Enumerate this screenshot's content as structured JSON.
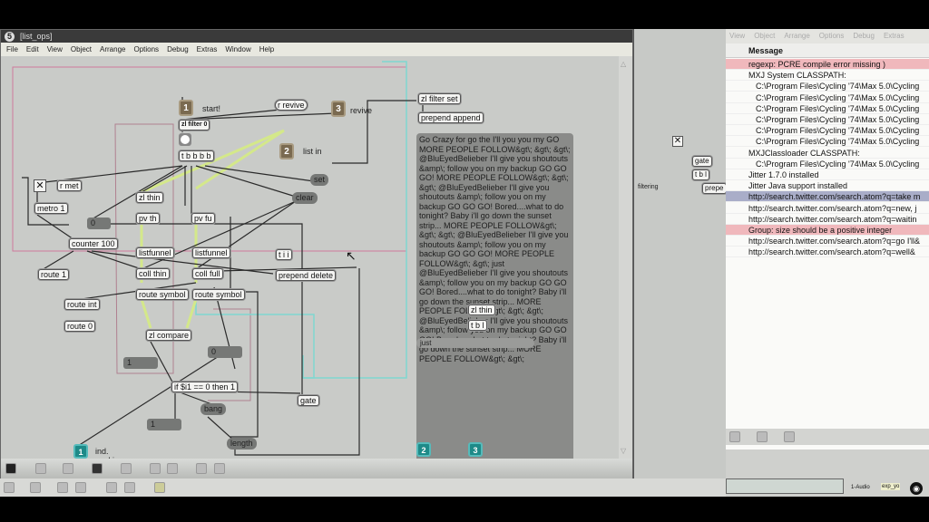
{
  "patcher": {
    "title_num": "5",
    "title": "[list_ops]",
    "menu": [
      "File",
      "Edit",
      "View",
      "Object",
      "Arrange",
      "Options",
      "Debug",
      "Extras",
      "Window",
      "Help"
    ],
    "inlets": [
      {
        "num": "1",
        "label": "start!"
      },
      {
        "num": "3",
        "label": "revive"
      },
      {
        "num": "2",
        "label": "list in"
      }
    ],
    "outlets": [
      {
        "num": "1",
        "label": "ind. working"
      },
      {
        "num": "2"
      },
      {
        "num": "3"
      }
    ],
    "objects": {
      "r_revive": "r revive",
      "zl_filter0": "zl filter 0",
      "tbbbb": "t b b b b",
      "r_met": "r met",
      "metro": "metro 1",
      "zl_thin": "zl thin",
      "pv_th": "pv th",
      "pv_fu": "pv fu",
      "counter": "counter 100",
      "listfunnel1": "listfunnel",
      "listfunnel2": "listfunnel",
      "tii": "t i i",
      "route1": "route 1",
      "coll_thin": "coll thin",
      "coll_full": "coll full",
      "prepend_delete": "prepend delete",
      "route_symbol1": "route symbol",
      "route_symbol2": "route symbol",
      "route_int": "route int",
      "route0": "route 0",
      "zl_compare": "zl compare",
      "if_expr": "if $i1 == 0 then 1",
      "gate": "gate",
      "zl_filter_set": "zl filter set",
      "prepend_append": "prepend append",
      "zl_thin2": "zl thin",
      "tbl": "t b l"
    },
    "messages": {
      "set": "set",
      "clear": "clear",
      "num0": "0",
      "num0b": "0",
      "num1a": "1",
      "num1b": "1",
      "bang": "bang",
      "length": "length",
      "just": "just"
    },
    "big_message": "Go Crazy for go the I'll you you my GO MORE PEOPLE FOLLOW&gt\\; &gt\\; &gt\\; @BluEyedBelieber I'll give you shoutouts &amp\\; follow you on my backup GO GO GO! MORE PEOPLE FOLLOW&gt\\; &gt\\; &gt\\; @BluEyedBelieber I'll give you shoutouts &amp\\; follow you on my backup GO GO GO! Bored....what to do tonight? Baby i'll go down the sunset strip... MORE PEOPLE FOLLOW&gt\\; &gt\\; &gt\\; @BluEyedBelieber I'll give you shoutouts &amp\\; follow you on my backup GO GO GO! MORE PEOPLE FOLLOW&gt\\; &gt\\; just @BluEyedBelieber I'll give you shoutouts &amp\\; follow you on my backup GO GO GO! Bored....what to do tonight? Baby i'll go down the sunset strip... MORE PEOPLE FOLLOW&gt\\; &gt\\; &gt\\; @BluEyedBelieber I'll give you shoutouts &amp\\; follow you on my backup GO GO GO! Bored....what to do tonight? Baby i'll go down the sunset strip... MORE PEOPLE FOLLOW&gt\\; &gt\\;"
  },
  "middle_window": {
    "gate": "gate",
    "tbl": "t b l",
    "prepend": "prepe",
    "filtering": "filtering",
    "audio": "1-Audio",
    "exp": "exp_yo"
  },
  "console": {
    "menu": [
      "View",
      "Object",
      "Arrange",
      "Options",
      "Debug",
      "Extras"
    ],
    "header": "Message",
    "rows": [
      {
        "text": "regexp: PCRE compile error missing )",
        "type": "err"
      },
      {
        "text": "MXJ System CLASSPATH:",
        "type": ""
      },
      {
        "text": "C:\\Program Files\\Cycling '74\\Max 5.0\\Cycling",
        "type": "ind"
      },
      {
        "text": "C:\\Program Files\\Cycling '74\\Max 5.0\\Cycling",
        "type": "ind"
      },
      {
        "text": "C:\\Program Files\\Cycling '74\\Max 5.0\\Cycling",
        "type": "ind"
      },
      {
        "text": "C:\\Program Files\\Cycling '74\\Max 5.0\\Cycling",
        "type": "ind"
      },
      {
        "text": "C:\\Program Files\\Cycling '74\\Max 5.0\\Cycling",
        "type": "ind"
      },
      {
        "text": "C:\\Program Files\\Cycling '74\\Max 5.0\\Cycling",
        "type": "ind"
      },
      {
        "text": "MXJClassloader CLASSPATH:",
        "type": ""
      },
      {
        "text": "C:\\Program Files\\Cycling '74\\Max 5.0\\Cycling",
        "type": "ind"
      },
      {
        "text": "Jitter 1.7.0 installed",
        "type": ""
      },
      {
        "text": "Jitter Java support installed",
        "type": ""
      },
      {
        "text": "http://search.twitter.com/search.atom?q=take m",
        "type": "sel"
      },
      {
        "text": "http://search.twitter.com/search.atom?q=new, j",
        "type": ""
      },
      {
        "text": "http://search.twitter.com/search.atom?q=waitin",
        "type": ""
      },
      {
        "text": "Group: size should be a positive integer",
        "type": "err"
      },
      {
        "text": "http://search.twitter.com/search.atom?q=go I'll&",
        "type": ""
      },
      {
        "text": "http://search.twitter.com/search.atom?q=well&",
        "type": ""
      }
    ]
  },
  "colors": {
    "patch_bg": "#c9cbc8",
    "error_row": "#f0b8bc",
    "selected_row": "#a9adc8",
    "inlet": "#7a6a50",
    "outlet": "#1e8a88",
    "wire_green": "#d4e88a",
    "wire_cyan": "#7fd8d0",
    "wire_pink": "#d07a9c"
  }
}
